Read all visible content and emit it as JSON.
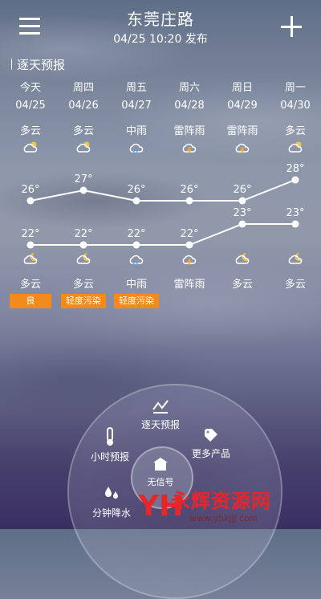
{
  "header": {
    "city": "东莞庄路",
    "publish": "04/25  10:20 发布"
  },
  "section_title": "逐天预报",
  "days": [
    {
      "day": "今天",
      "date": "04/25",
      "day_weather": "多云",
      "night_weather": "多云",
      "high": "26°",
      "low": "22°",
      "high_value": 26,
      "low_value": 22,
      "aqi": "良",
      "day_icon": "partly-cloudy-icon",
      "night_icon": "partly-cloudy-night-icon"
    },
    {
      "day": "周四",
      "date": "04/26",
      "day_weather": "多云",
      "night_weather": "多云",
      "high": "27°",
      "low": "22°",
      "high_value": 27,
      "low_value": 22,
      "aqi": "轻度污染",
      "day_icon": "partly-cloudy-icon",
      "night_icon": "partly-cloudy-night-icon"
    },
    {
      "day": "周五",
      "date": "04/27",
      "day_weather": "中雨",
      "night_weather": "中雨",
      "high": "26°",
      "low": "22°",
      "high_value": 26,
      "low_value": 22,
      "aqi": "轻度污染",
      "day_icon": "rain-icon",
      "night_icon": "rain-icon"
    },
    {
      "day": "周六",
      "date": "04/28",
      "day_weather": "雷阵雨",
      "night_weather": "雷阵雨",
      "high": "26°",
      "low": "22°",
      "high_value": 26,
      "low_value": 22,
      "aqi": "",
      "day_icon": "thunderstorm-icon",
      "night_icon": "thunderstorm-icon"
    },
    {
      "day": "周日",
      "date": "04/29",
      "day_weather": "雷阵雨",
      "night_weather": "多云",
      "high": "26°",
      "low": "23°",
      "high_value": 26,
      "low_value": 23,
      "aqi": "",
      "day_icon": "thunderstorm-icon",
      "night_icon": "partly-cloudy-night-icon"
    },
    {
      "day": "周一",
      "date": "04/30",
      "day_weather": "多云",
      "night_weather": "多云",
      "high": "28°",
      "low": "23°",
      "high_value": 28,
      "low_value": 23,
      "aqi": "",
      "day_icon": "partly-cloudy-icon",
      "night_icon": "partly-cloudy-night-icon"
    }
  ],
  "dial": {
    "daily": "逐天预报",
    "hourly": "小时预报",
    "more": "更多产品",
    "signal": "无信号",
    "minute_rain": "分钟降水"
  },
  "watermark": {
    "name": "永辉资源网",
    "url": "www.yhkjjj.com"
  },
  "colors": {
    "badge": "#f28a1c",
    "watermark_red": "#e8262a"
  }
}
